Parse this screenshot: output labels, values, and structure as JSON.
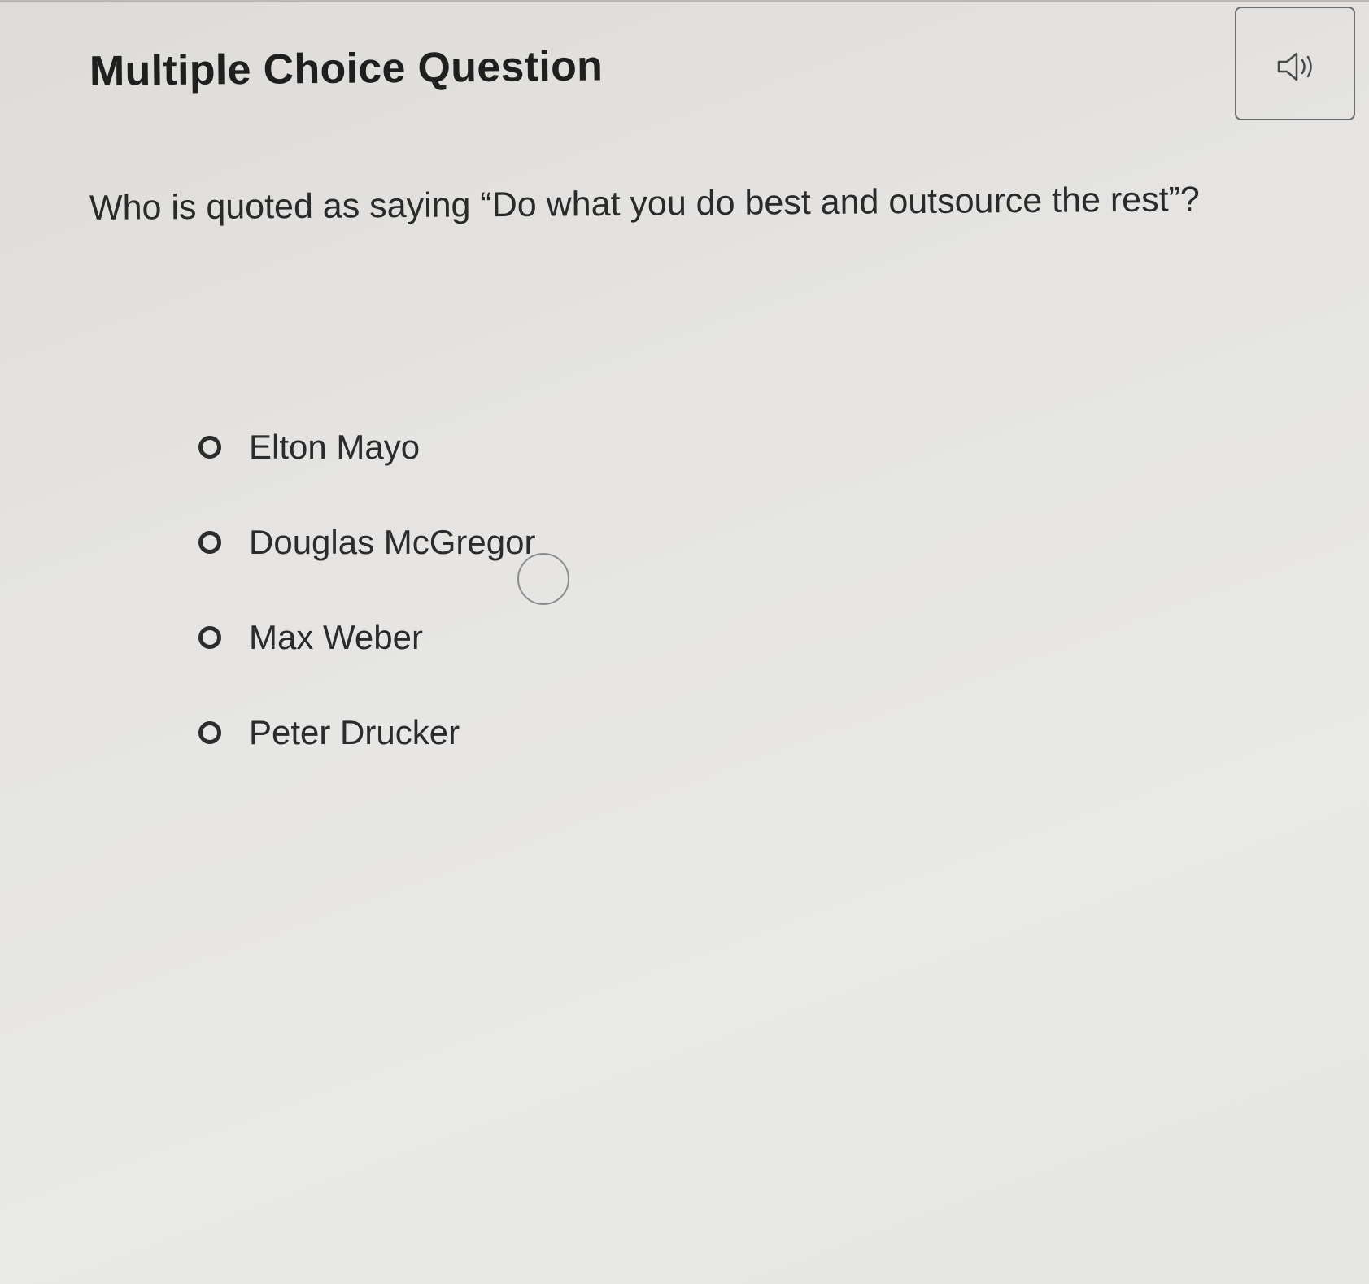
{
  "header": {
    "title": "Multiple Choice Question",
    "audio_icon": "speaker-icon"
  },
  "question": {
    "text": "Who is quoted as saying “Do what you do best and outsource the rest”?"
  },
  "options": [
    {
      "label": "Elton Mayo",
      "selected": false
    },
    {
      "label": "Douglas McGregor",
      "selected": false
    },
    {
      "label": "Max Weber",
      "selected": false
    },
    {
      "label": "Peter Drucker",
      "selected": false
    }
  ]
}
